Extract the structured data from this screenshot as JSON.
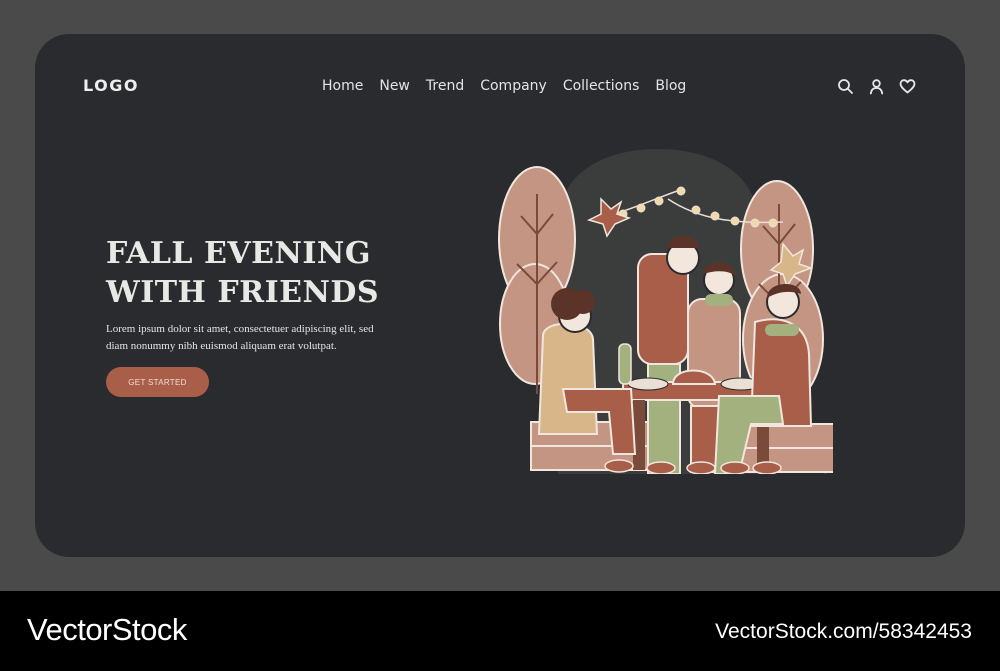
{
  "header": {
    "logo": "LOGO",
    "nav": [
      "Home",
      "New",
      "Trend",
      "Company",
      "Collections",
      "Blog"
    ],
    "icons": [
      "search-icon",
      "user-icon",
      "heart-icon"
    ]
  },
  "hero": {
    "title_line1": "FALL EVENING",
    "title_line2": "WITH FRIENDS",
    "body_line1": "Lorem ipsum dolor sit amet, consectetuer adipiscing elit, sed",
    "body_line2": "diam nonummy nibh euismod aliquam erat volutpat.",
    "cta_label": "GET STARTED"
  },
  "footer": {
    "brand": "VectorStock",
    "url": "VectorStock.com/58342453"
  },
  "colors": {
    "page_bg": "#4a4a4a",
    "card_bg": "#2a2b2e",
    "accent": "#a85e49",
    "text": "#e8e9e4"
  }
}
